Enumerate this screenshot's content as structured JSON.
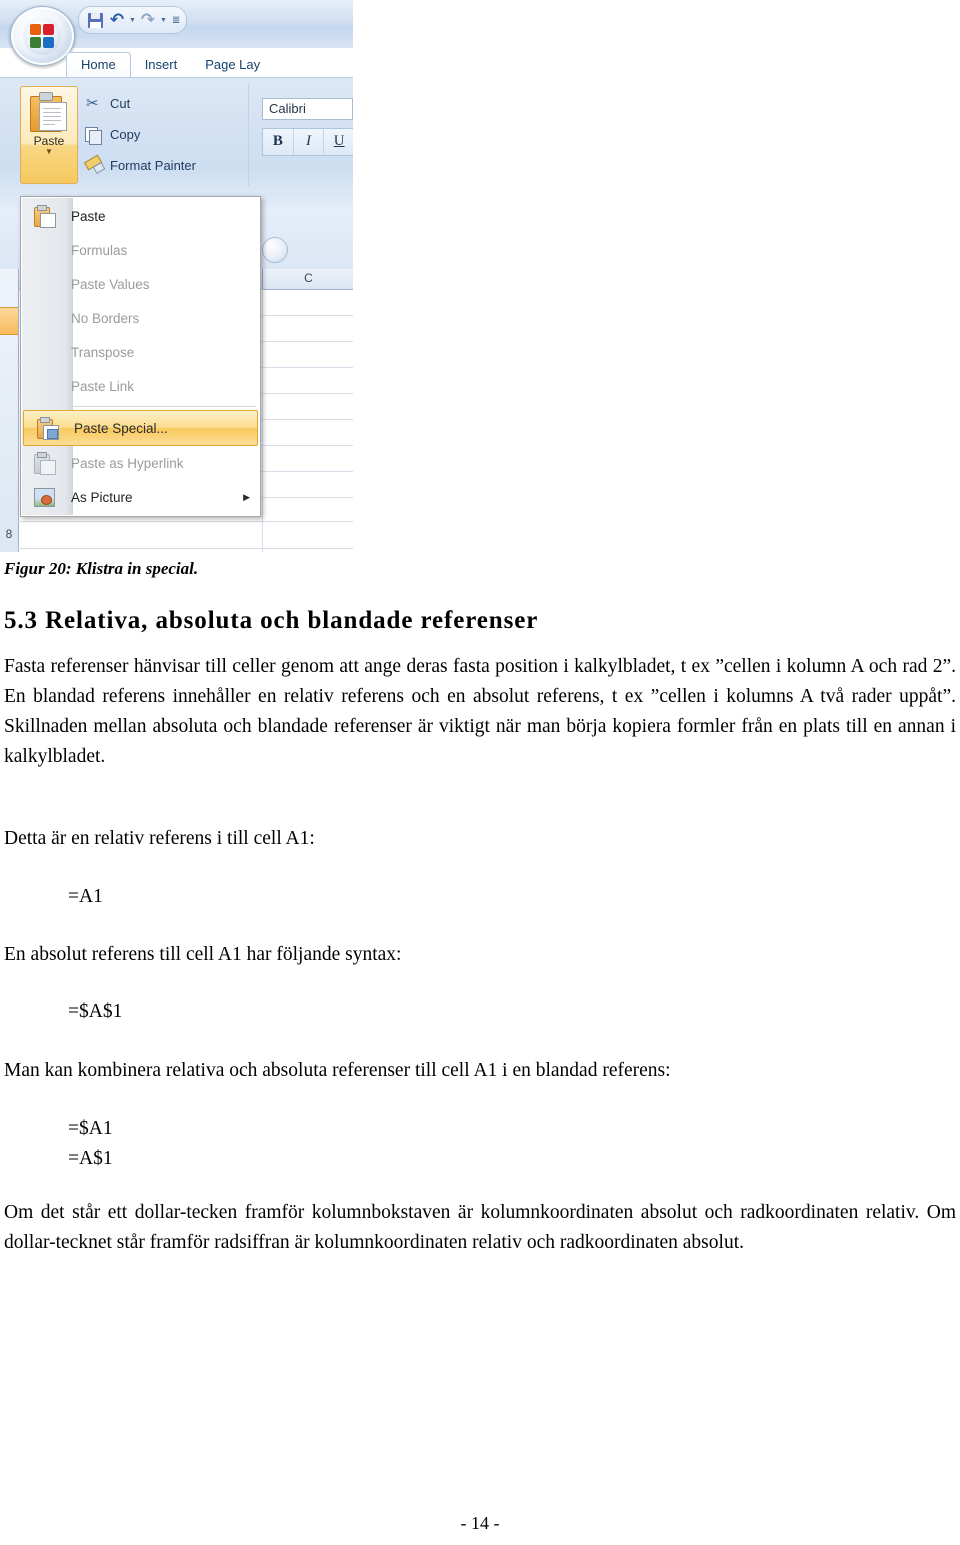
{
  "excel": {
    "office_button": "office-orb",
    "quick_access": [
      {
        "name": "save-icon",
        "label": "Save"
      },
      {
        "name": "undo-icon",
        "label": "Undo"
      },
      {
        "name": "redo-icon",
        "label": "Redo"
      },
      {
        "name": "customize-qat-icon",
        "label": "Customize Quick Access Toolbar"
      }
    ],
    "tabs": [
      {
        "label": "Home",
        "active": true
      },
      {
        "label": "Insert",
        "active": false
      },
      {
        "label": "Page Lay",
        "active": false
      }
    ],
    "clipboard_group": {
      "paste_label": "Paste",
      "commands": [
        {
          "label": "Cut",
          "icon": "scissors-icon"
        },
        {
          "label": "Copy",
          "icon": "copy-icon"
        },
        {
          "label": "Format Painter",
          "icon": "paintbrush-icon"
        }
      ]
    },
    "font_group": {
      "font_name": "Calibri",
      "bold": "B",
      "italic": "I",
      "underline": "U"
    },
    "grid": {
      "column_header": "C",
      "row_number": "8"
    },
    "paste_menu": [
      {
        "label": "Paste",
        "accel": "P",
        "disabled": false,
        "selected": false,
        "icon": "paste-icon"
      },
      {
        "label": "Formulas",
        "accel": "F",
        "disabled": true,
        "selected": false,
        "icon": "paste-formulas-icon"
      },
      {
        "label": "Paste Values",
        "accel": "V",
        "disabled": true,
        "selected": false,
        "icon": "paste-values-icon"
      },
      {
        "label": "No Borders",
        "accel": "B",
        "disabled": true,
        "selected": false,
        "icon": "no-borders-icon"
      },
      {
        "label": "Transpose",
        "accel": "T",
        "disabled": true,
        "selected": false,
        "icon": "transpose-icon"
      },
      {
        "label": "Paste Link",
        "accel": "k",
        "disabled": true,
        "selected": false,
        "icon": "paste-link-icon"
      },
      {
        "label": "Paste Special...",
        "accel": "S",
        "disabled": false,
        "selected": true,
        "icon": "paste-special-icon"
      },
      {
        "label": "Paste as Hyperlink",
        "accel": "H",
        "disabled": true,
        "selected": false,
        "icon": "paste-hyperlink-icon"
      },
      {
        "label": "As Picture",
        "accel": "A",
        "disabled": false,
        "selected": false,
        "icon": "as-picture-icon",
        "submenu": true
      }
    ]
  },
  "document": {
    "figure_caption": "Figur 20: Klistra in special.",
    "heading": "5.3 Relativa, absoluta och blandade referenser",
    "paragraph_intro": "Fasta referenser hänvisar till celler genom att ange deras fasta position i kalkylbladet, t ex ”cellen i kolumn A och rad 2”. En blandad referens innehåller en relativ referens och en absolut referens, t ex ”cellen i kolumns A två rader uppåt”. Skillnaden mellan absoluta och blandade referenser är viktigt när man börja kopiera formler från en plats till en annan i kalkylbladet.",
    "paragraph_relativ": "Detta är en relativ referens i till cell A1:",
    "code_relativ": "=A1",
    "paragraph_absolut": "En absolut referens till cell A1 har följande syntax:",
    "code_absolut": "=$A$1",
    "paragraph_kombinera": "Man kan kombinera relativa och absoluta referenser till cell A1 i en blandad referens:",
    "code_mixed_1": "=$A1",
    "code_mixed_2": "=A$1",
    "paragraph_dollar": "Om det står ett dollar-tecken framför kolumnbokstaven är kolumnkoordinaten absolut och radkoordinaten relativ. Om dollar-tecknet står framför radsiffran är kolumnkoordinaten relativ och radkoordinaten absolut.",
    "page_number": "- 14 -"
  }
}
